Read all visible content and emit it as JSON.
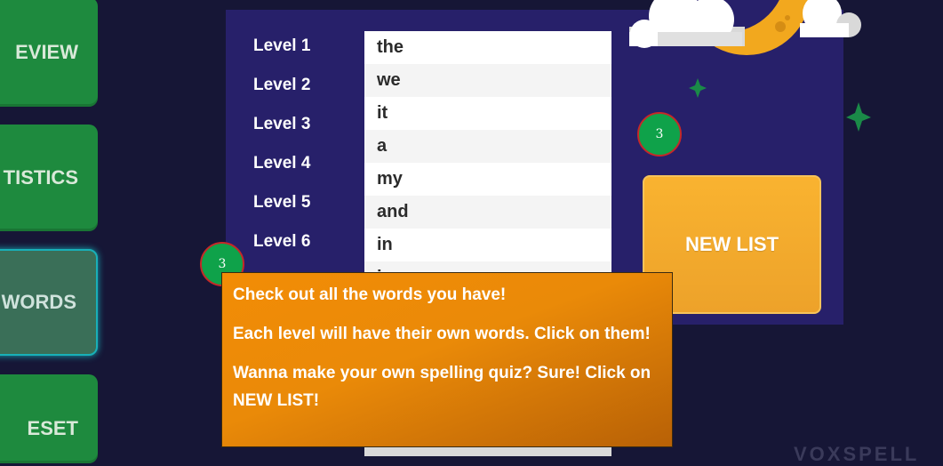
{
  "sidebar": {
    "items": [
      {
        "label": "EVIEW"
      },
      {
        "label": "TISTICS"
      },
      {
        "label": "WORDS"
      },
      {
        "label": "ESET"
      }
    ]
  },
  "levels": [
    "Level 1",
    "Level 2",
    "Level 3",
    "Level 4",
    "Level 5",
    "Level 6"
  ],
  "words": [
    "the",
    "we",
    "it",
    "a",
    "my",
    "and",
    "in",
    "i"
  ],
  "new_list_label": "NEW LIST",
  "badges": [
    "3",
    "3"
  ],
  "tooltip": {
    "lines": [
      "Check out all the words you have!",
      "Each level will have their own words. Click on them!",
      "Wanna make your own spelling quiz? Sure! Click on NEW LIST!"
    ]
  },
  "footer_logo": "VOXSPELL",
  "colors": {
    "background": "#161636",
    "panel": "#27206a",
    "sidebar_button": "#1e8a3e",
    "accent_orange": "#f9b330",
    "tooltip": "#f28c06",
    "badge": "#0fa24a"
  }
}
